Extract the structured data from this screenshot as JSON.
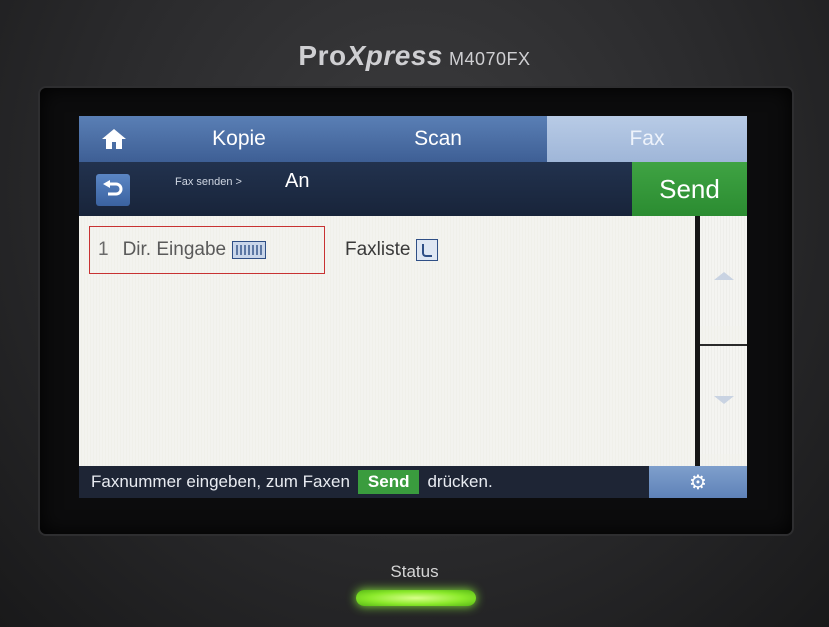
{
  "device": {
    "brand_pro": "Pro",
    "brand_xpress": "Xpress",
    "model": "M4070FX",
    "status_label": "Status"
  },
  "tabs": [
    {
      "label": "Kopie",
      "active": false
    },
    {
      "label": "Scan",
      "active": false
    },
    {
      "label": "Fax",
      "active": true
    }
  ],
  "header": {
    "breadcrumb": "Fax senden >",
    "title": "An",
    "send_label": "Send"
  },
  "options": {
    "direct_number": "1",
    "direct_label": "Dir. Eingabe",
    "faxlist_label": "Faxliste"
  },
  "statusbar": {
    "text_before": "Faxnummer eingeben, zum Faxen",
    "send_chip": "Send",
    "text_after": "drücken."
  },
  "icons": {
    "home": "home-icon",
    "back": "back-arrow-icon",
    "keyboard": "keyboard-icon",
    "phonebook": "phonebook-icon",
    "settings": "gear-icon",
    "scroll_up": "scroll-up-icon",
    "scroll_down": "scroll-down-icon"
  },
  "colors": {
    "tab_blue": "#4a6ea5",
    "active_tab": "#aec3e2",
    "send_green": "#35983a",
    "header_dark": "#1e2c45",
    "highlight_red": "#c83232",
    "status_led": "#8cea2c"
  }
}
